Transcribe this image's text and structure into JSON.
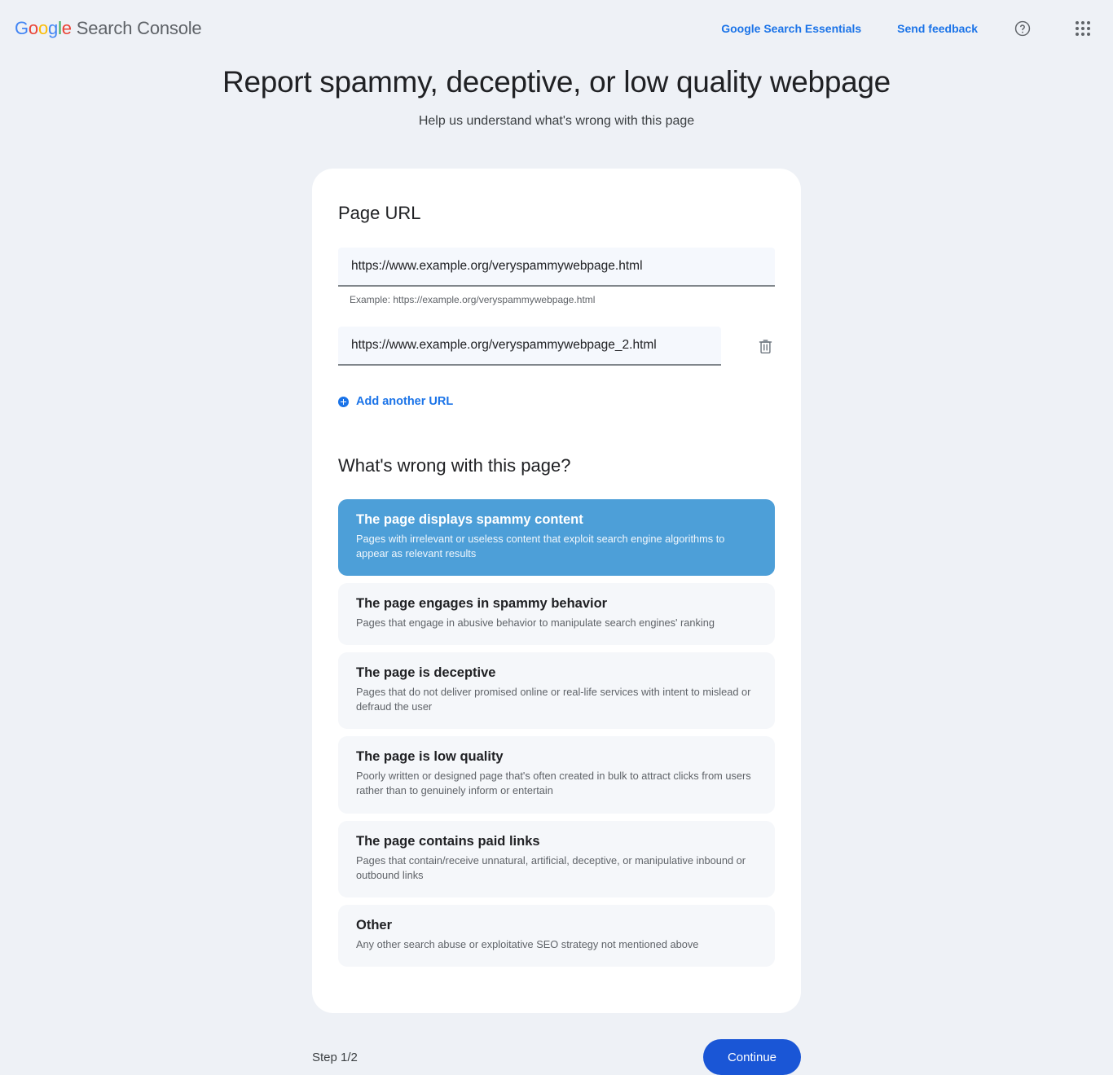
{
  "header": {
    "brand": {
      "g": "G",
      "o1": "o",
      "o2": "o",
      "g2": "g",
      "l": "l",
      "e": "e",
      "suffix": " Search Console"
    },
    "links": [
      {
        "label": "Google Search Essentials",
        "name": "google-search-essentials-link"
      },
      {
        "label": "Send feedback",
        "name": "send-feedback-link"
      }
    ],
    "help_icon": "help-icon",
    "apps_icon": "apps-grid-icon"
  },
  "page": {
    "title": "Report spammy, deceptive, or low quality webpage",
    "subtitle": "Help us understand what's wrong with this page"
  },
  "url_section": {
    "heading": "Page URL",
    "inputs": [
      {
        "value": "https://www.example.org/veryspammywebpage.html",
        "placeholder": "https://example.org/veryspammywebpage.html"
      },
      {
        "value": "https://www.example.org/veryspammywebpage_2.html",
        "placeholder": "https://example.org/veryspammywebpage.html"
      }
    ],
    "helper": "Example: https://example.org/veryspammywebpage.html",
    "delete_icon": "trash-icon",
    "add_label": "Add another URL",
    "add_icon": "plus-circle-icon"
  },
  "issue_section": {
    "heading": "What's wrong with this page?",
    "options": [
      {
        "title": "The page displays spammy content",
        "description": "Pages with irrelevant or useless content that exploit search engine algorithms to appear as relevant results",
        "selected": true
      },
      {
        "title": "The page engages in spammy behavior",
        "description": "Pages that engage in abusive behavior to manipulate search engines' ranking",
        "selected": false
      },
      {
        "title": "The page is deceptive",
        "description": "Pages that do not deliver promised online or real-life services with intent to mislead or defraud the user",
        "selected": false
      },
      {
        "title": "The page is low quality",
        "description": "Poorly written or designed page that's often created in bulk to attract clicks from users rather than to genuinely inform or entertain",
        "selected": false
      },
      {
        "title": "The page contains paid links",
        "description": "Pages that contain/receive unnatural, artificial, deceptive, or manipulative inbound or outbound links",
        "selected": false
      },
      {
        "title": "Other",
        "description": "Any other search abuse or exploitative SEO strategy not mentioned above",
        "selected": false
      }
    ]
  },
  "footer": {
    "step": "Step 1/2",
    "continue_label": "Continue"
  },
  "colors": {
    "page_background": "#eef1f6",
    "card_background": "#ffffff",
    "accent_blue": "#1a73e8",
    "selected_option": "#4d9fd8",
    "continue_button": "#1a56d6",
    "option_background": "#f5f7fa"
  }
}
